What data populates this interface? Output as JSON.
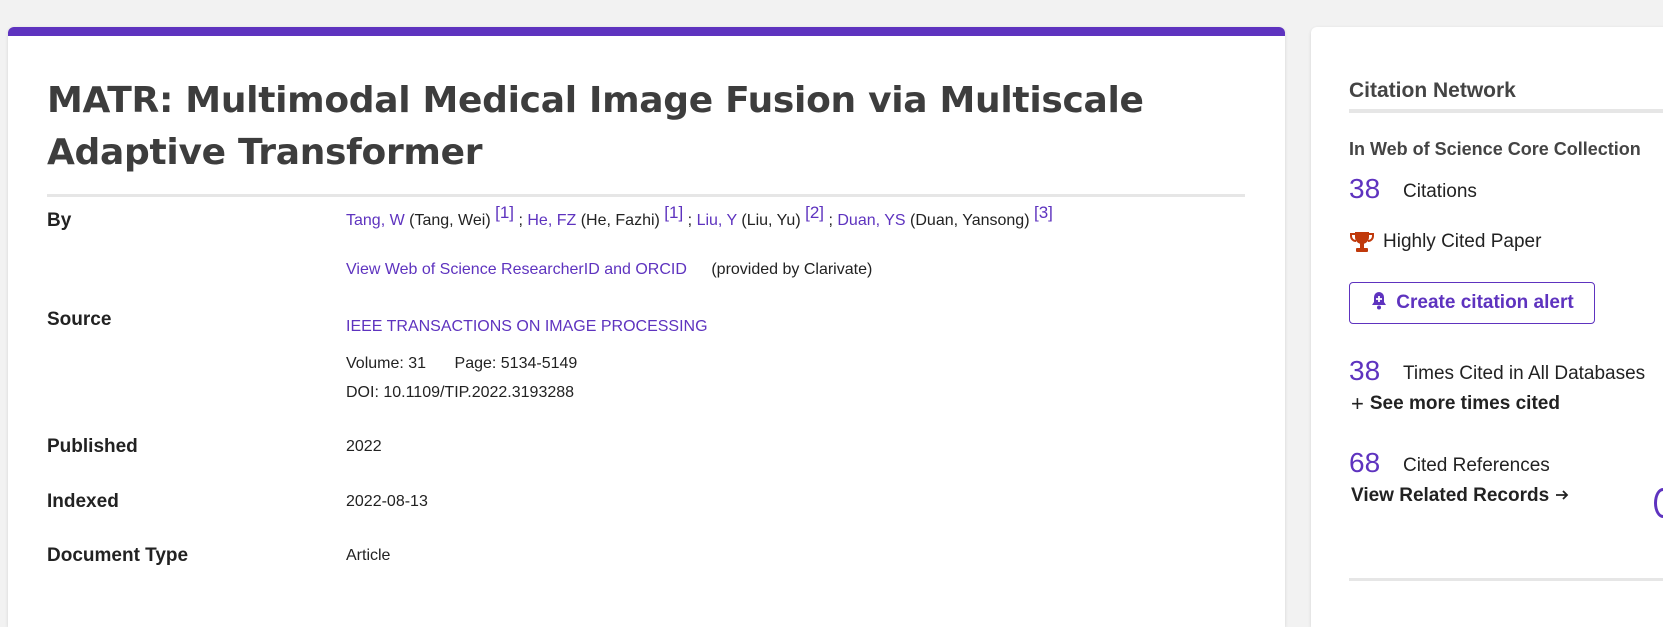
{
  "record": {
    "title": "MATR: Multimodal Medical Image Fusion via Multiscale Adaptive Transformer",
    "by_label": "By",
    "authors": [
      {
        "short": "Tang, W",
        "full": "(Tang, Wei)",
        "ref": "[1]"
      },
      {
        "short": "He, FZ",
        "full": "(He, Fazhi)",
        "ref": "[1]"
      },
      {
        "short": "Liu, Y",
        "full": "(Liu, Yu)",
        "ref": "[2]"
      },
      {
        "short": "Duan, YS",
        "full": "(Duan, Yansong)",
        "ref": "[3]"
      }
    ],
    "author_separator": ";",
    "researcher_link": "View Web of Science ResearcherID and ORCID",
    "provided_by": "(provided by Clarivate)",
    "source_label": "Source",
    "source": "IEEE TRANSACTIONS ON IMAGE PROCESSING",
    "volume": "Volume: 31",
    "page": "Page: 5134-5149",
    "doi": "DOI: 10.1109/TIP.2022.3193288",
    "published_label": "Published",
    "published": "2022",
    "indexed_label": "Indexed",
    "indexed": "2022-08-13",
    "doctype_label": "Document Type",
    "doctype": "Article"
  },
  "citation_network": {
    "title": "Citation Network",
    "collection_label": "In Web of Science Core Collection",
    "citations_count": "38",
    "citations_label": "Citations",
    "highly_cited": "Highly Cited Paper",
    "alert_button": "Create citation alert",
    "all_db_count": "38",
    "all_db_label": "Times Cited in All Databases",
    "see_more": "See more times cited",
    "cited_refs_count": "68",
    "cited_refs_label": "Cited References",
    "view_related": "View Related Records"
  },
  "colors": {
    "accent": "#5e33bf",
    "trophy": "#c0390b"
  },
  "icons": {
    "trophy": "trophy-icon",
    "bell": "bell-plus-icon",
    "plus": "plus-icon",
    "arrow": "arrow-right-icon"
  }
}
